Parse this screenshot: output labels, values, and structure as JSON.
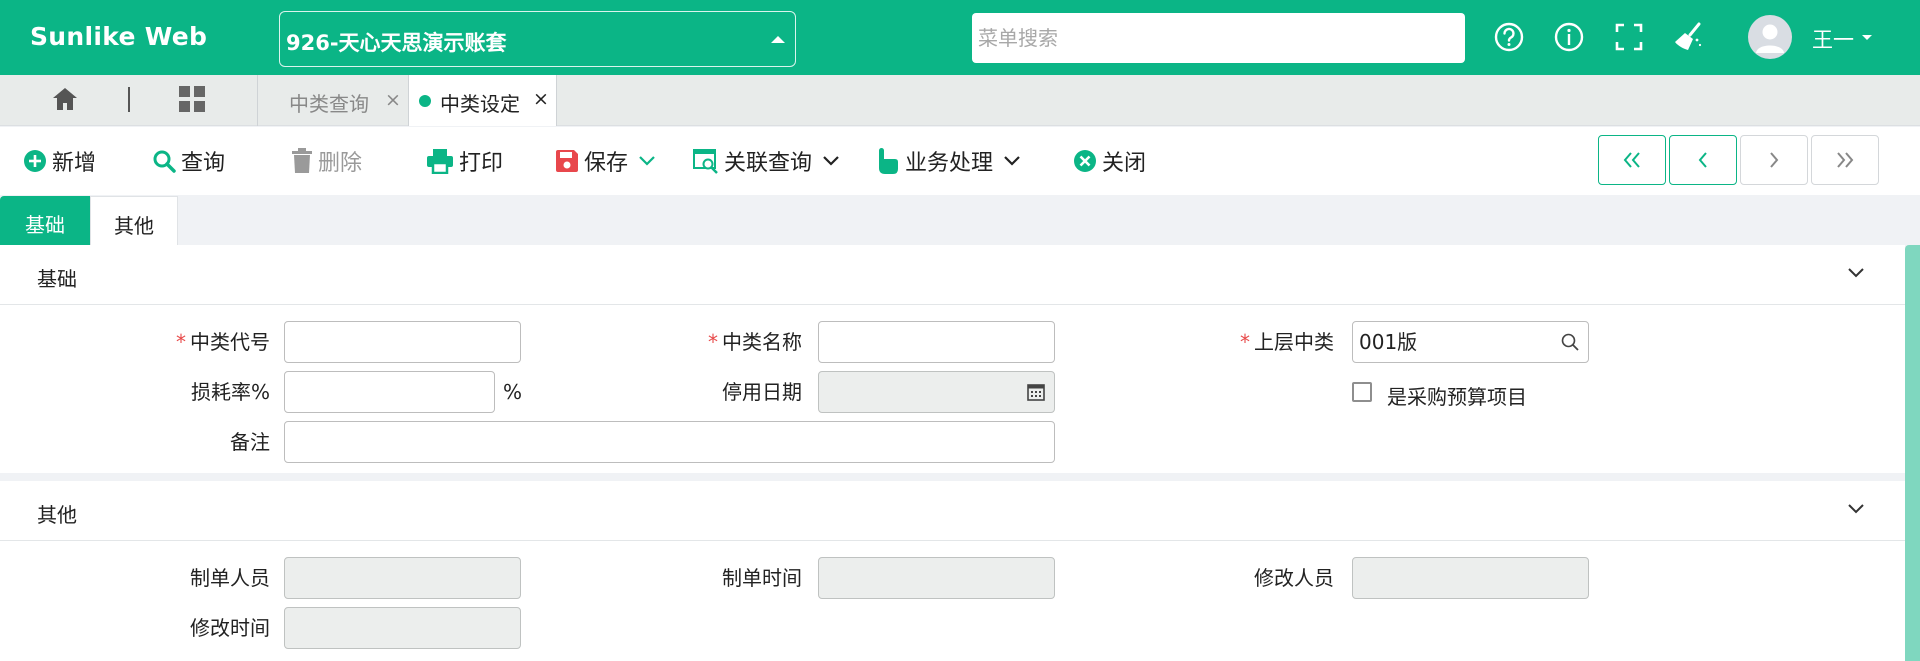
{
  "header": {
    "brand": "Sunlike Web",
    "account": "926-天心天思演示账套",
    "search_placeholder": "菜单搜索",
    "user": "王一",
    "icons": [
      "help-circle-icon",
      "info-circle-icon",
      "fullscreen-icon",
      "broom-icon"
    ]
  },
  "tabs": {
    "open": [
      {
        "label": "中类查询",
        "active": false
      },
      {
        "label": "中类设定",
        "active": true
      }
    ],
    "close_glyph": "×"
  },
  "toolbar": {
    "new_label": "新增",
    "query_label": "查询",
    "delete_label": "删除",
    "print_label": "打印",
    "save_label": "保存",
    "related_query_label": "关联查询",
    "business_label": "业务处理",
    "close_label": "关闭"
  },
  "form_tabs": [
    "基础",
    "其他"
  ],
  "sections": {
    "basic": {
      "title": "基础",
      "fields": {
        "code_label": "中类代号",
        "code_value": "",
        "name_label": "中类名称",
        "name_value": "",
        "parent_label": "上层中类",
        "parent_value": "001版",
        "loss_label": "损耗率%",
        "loss_value": "",
        "loss_unit": "%",
        "stop_date_label": "停用日期",
        "stop_date_value": "",
        "purchase_budget_label": "是采购预算项目",
        "purchase_budget_checked": false,
        "remark_label": "备注",
        "remark_value": ""
      }
    },
    "other": {
      "title": "其他",
      "fields": {
        "creator_label": "制单人员",
        "create_time_label": "制单时间",
        "modifier_label": "修改人员",
        "modify_time_label": "修改时间"
      }
    }
  },
  "colors": {
    "brand": "#0bb586",
    "required": "#e84a4a"
  }
}
